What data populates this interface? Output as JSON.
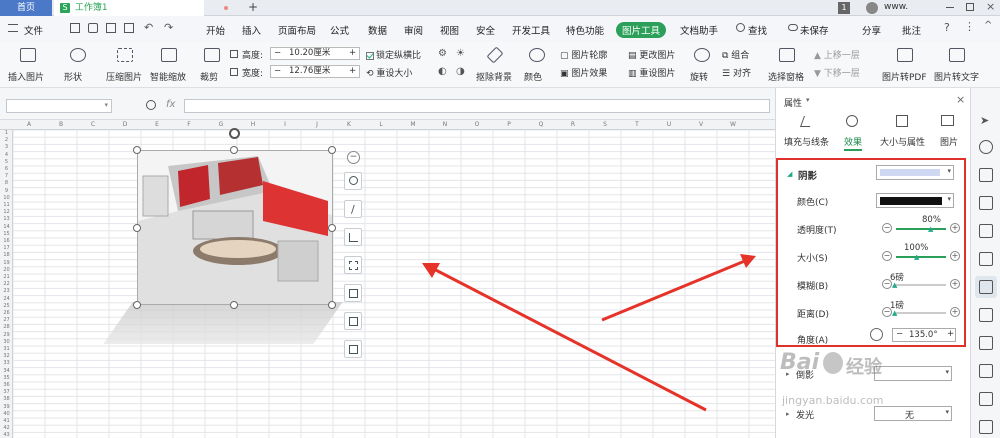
{
  "titlebar": {
    "home_tab": "首页",
    "doc_tab": "工作簿1",
    "doc_icon_letter": "S",
    "new_tab": "+",
    "page_badge": "1",
    "user": "www."
  },
  "menu": {
    "file": "文件",
    "items": [
      "开始",
      "插入",
      "页面布局",
      "公式",
      "数据",
      "审阅",
      "视图",
      "安全",
      "开发工具",
      "特色功能",
      "图片工具",
      "文档助手"
    ],
    "active": "图片工具",
    "search": "查找",
    "unsaved": "未保存",
    "share": "分享",
    "comment": "批注"
  },
  "ribbon": {
    "insert_picture": "插入图片",
    "shape": "形状",
    "compress": "压缩图片",
    "smart_scale": "智能缩放",
    "crop": "裁剪",
    "height_label": "高度:",
    "height_value": "10.20厘米",
    "width_label": "宽度:",
    "width_value": "12.76厘米",
    "lock_ratio": "锁定纵横比",
    "reset_size": "重设大小",
    "remove_bg": "抠除背景",
    "color": "颜色",
    "picture_outline": "图片轮廓",
    "picture_effect": "图片效果",
    "change_picture": "更改图片",
    "reset_picture": "重设图片",
    "rotate": "旋转",
    "group": "组合",
    "align": "对齐",
    "select_pane": "选择窗格",
    "move_up": "上移一层",
    "move_down": "下移一层",
    "to_pdf": "图片转PDF",
    "to_text": "图片转文字"
  },
  "formula": {
    "fx": "fx"
  },
  "sheet": {
    "columns": [
      "A",
      "B",
      "C",
      "D",
      "E",
      "F",
      "G",
      "H",
      "I",
      "J",
      "K",
      "L",
      "M",
      "N",
      "O",
      "P",
      "Q",
      "R",
      "S",
      "T",
      "U",
      "V",
      "W"
    ],
    "rows": [
      "1",
      "2",
      "3",
      "4",
      "5",
      "6",
      "7",
      "8",
      "9",
      "10",
      "11",
      "12",
      "13",
      "14",
      "15",
      "16",
      "17",
      "18",
      "19",
      "20",
      "21",
      "22",
      "23",
      "24",
      "25",
      "26",
      "27",
      "28",
      "29",
      "30",
      "31",
      "32",
      "33",
      "34",
      "35",
      "36",
      "37",
      "38",
      "39",
      "40",
      "41",
      "42",
      "43"
    ]
  },
  "pane": {
    "title": "属性",
    "tabs": [
      "填充与线条",
      "效果",
      "大小与属性",
      "图片"
    ],
    "active_tab": "效果",
    "section": "阴影",
    "props": {
      "color_label": "颜色(C)",
      "transparency_label": "透明度(T)",
      "transparency_value": "80%",
      "size_label": "大小(S)",
      "size_value": "100%",
      "blur_label": "模糊(B)",
      "blur_value": "6磅",
      "distance_label": "距离(D)",
      "distance_value": "1磅",
      "angle_label": "角度(A)",
      "angle_value": "135.0°"
    },
    "reflection_label": "倒影",
    "glow_label": "发光",
    "glow_value": "无"
  },
  "watermark": {
    "brand": "Bai",
    "brand2": "经验",
    "url": "jingyan.baidu.com"
  },
  "colors": {
    "accent": "#2ca05a",
    "highlight_box": "#e0302a",
    "arrow": "#e5332a",
    "home_tab": "#4b79c7"
  }
}
